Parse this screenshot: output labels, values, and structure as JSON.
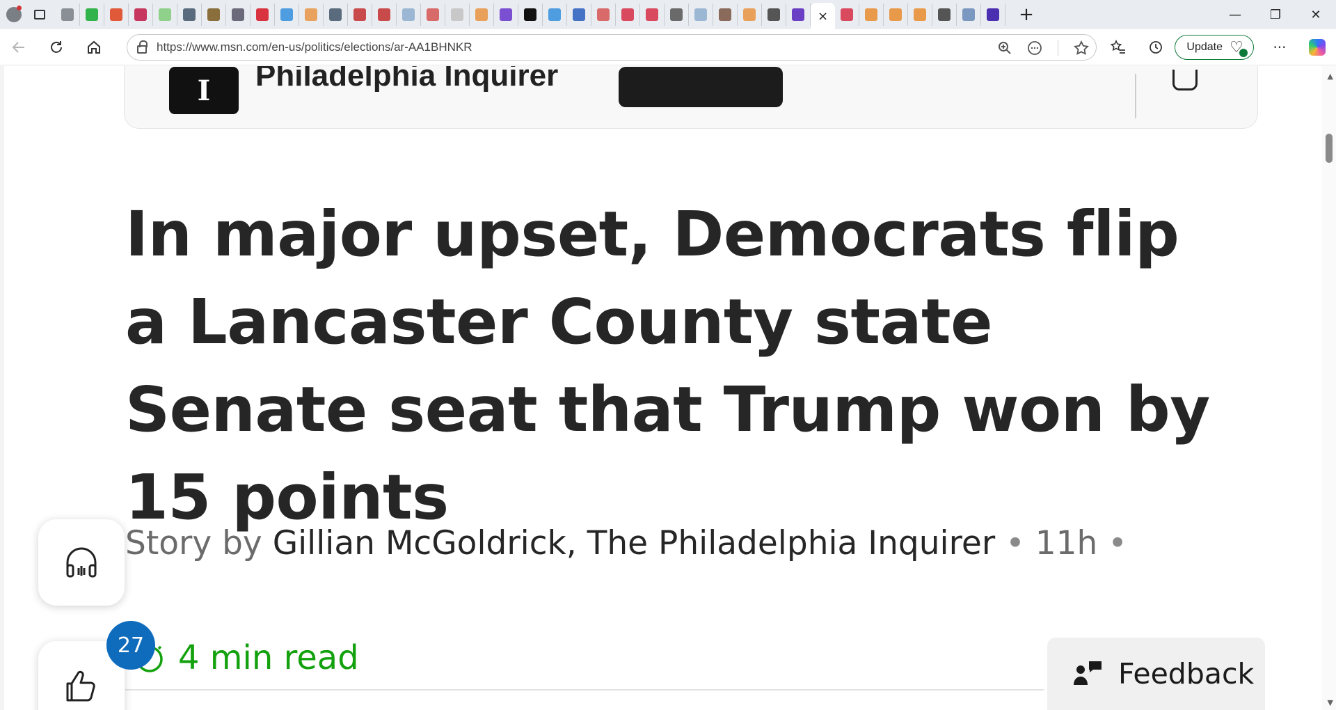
{
  "browser": {
    "tab_colors": [
      "#8a8f96",
      "#2fb34a",
      "#e05a3a",
      "#c7365f",
      "#8fd08a",
      "#5a6b7d",
      "#8a6e3c",
      "#6a6a7a",
      "#d9333f",
      "#4d9de0",
      "#e8a25d",
      "#5a6b7d",
      "#c94a4a",
      "#c94a4a",
      "#9bb7d4",
      "#d86a6a",
      "#c8c8c8",
      "#e8a05a",
      "#7b4fd1",
      "#111111",
      "#4d9de0",
      "#4472c4",
      "#d86a6a",
      "#d94a5f",
      "#d94a5f",
      "#6a6a6a",
      "#9bb7d4",
      "#8a6a5a",
      "#e8a05a",
      "#555555",
      "#6a3fc6",
      "#d94a5f",
      "#e89a4a",
      "#e89a4a",
      "#e89a4a",
      "#555555",
      "#7a98c0",
      "#4a2fb0"
    ],
    "active_tab_close": "×",
    "new_tab": "+",
    "window_controls": {
      "minimize": "—",
      "restore": "❐",
      "close": "✕"
    },
    "url": "https://www.msn.com/en-us/politics/elections/ar-AA1BHNKR",
    "update_label": "Update",
    "more_label": "···"
  },
  "card": {
    "logo_glyph": "I",
    "name": "Philadelphia Inquirer"
  },
  "article": {
    "headline": "In major upset, Democrats flip a Lancaster County state Senate seat that Trump won by 15 points",
    "byline_prefix": "Story by ",
    "author": "Gillian McGoldrick, The Philadelphia Inquirer",
    "sep": " • ",
    "age": "11h",
    "sep2": " •",
    "read_time": "4 min read"
  },
  "actions": {
    "like_count": "27",
    "feedback_label": "Feedback"
  },
  "colors": {
    "accent_green": "#13a10e",
    "like_badge": "#0f6cbd"
  }
}
